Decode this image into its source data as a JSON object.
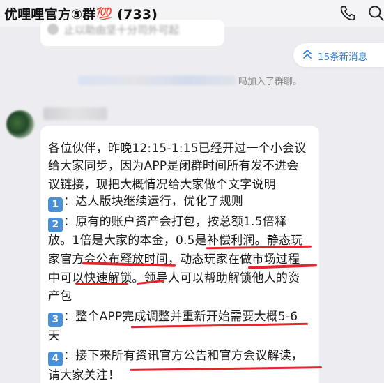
{
  "header": {
    "title": "优哩哩官方⑤群💯 (733)",
    "icons": [
      "phone-icon",
      "search-icon"
    ]
  },
  "previous_message": {
    "text": "止以助由坚十分司外可起"
  },
  "unread_button": {
    "label": "15条新消息"
  },
  "system_notice": {
    "suffix": "吗加入了群聊。"
  },
  "message": {
    "lines": [
      {
        "text": "各位伙伴，昨晚12:15-1:15已经开过一个小会议"
      },
      {
        "text": "给大家同步，因为APP是闭群时间所有发不进会"
      },
      {
        "text": "议链接，现把大概情况给大家做个文字说明"
      },
      {
        "key": "1",
        "text": "：达人版块继续运行，优化了规则"
      },
      {
        "key": "2",
        "text": "：原有的账户资产会打包，按总额1.5倍释"
      },
      {
        "text": "放。1倍是大家的本金，0.5是补偿利润。静态玩"
      },
      {
        "text": "家官方会公布释放时间，动态玩家在做市场过程"
      },
      {
        "text": "中可以快速解锁。领导人可以帮助解锁他人的资"
      },
      {
        "text": "产包"
      },
      {
        "key": "3",
        "text": "：整个APP完成调整并重新开始需要大概5-6"
      },
      {
        "text": "天"
      },
      {
        "key": "4",
        "text": "：接下来所有资讯官方公告和官方会议解读，"
      },
      {
        "text": "请大家关注！"
      }
    ]
  },
  "colors": {
    "accent_blue": "#2f7fd8",
    "keycap_blue": "#4a90d9",
    "annotation_red": "#e2262e",
    "background": "#ededf1"
  }
}
